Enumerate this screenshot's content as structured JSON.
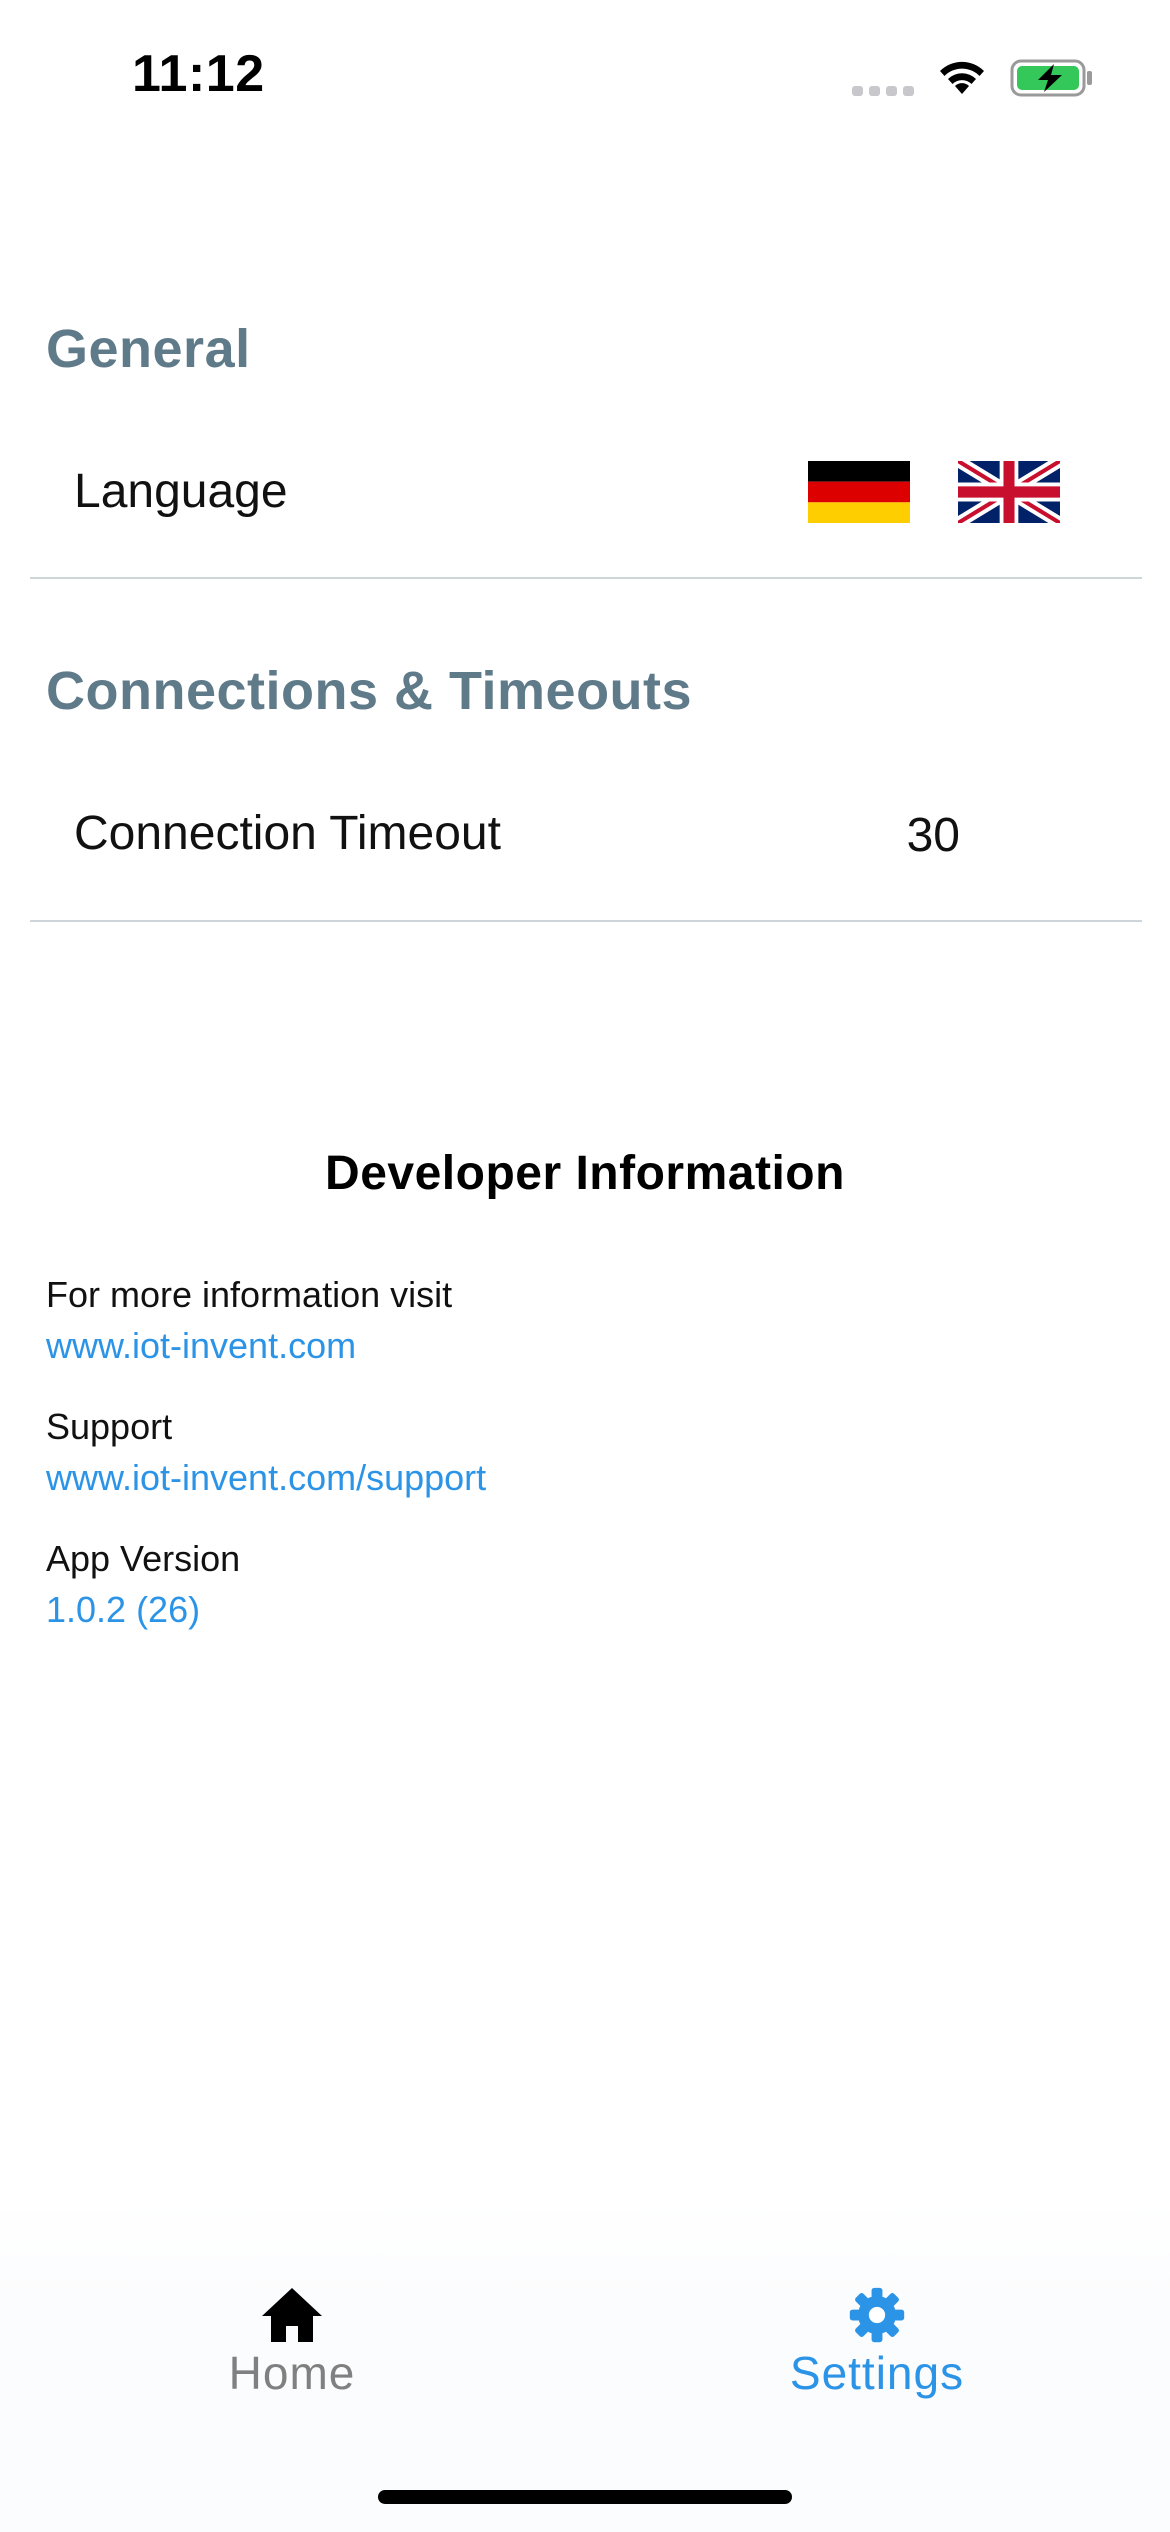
{
  "status_bar": {
    "time": "11:12"
  },
  "general": {
    "header": "General",
    "language_label": "Language",
    "flags": [
      "german-flag",
      "uk-flag"
    ]
  },
  "connections": {
    "header": "Connections & Timeouts",
    "timeout_label": "Connection Timeout",
    "timeout_value": "30"
  },
  "developer": {
    "title": "Developer Information",
    "more_info_label": "For more information visit",
    "more_info_link": "www.iot-invent.com",
    "support_label": "Support",
    "support_link": "www.iot-invent.com/support",
    "version_label": "App Version",
    "version_value": "1.0.2 (26)"
  },
  "tab_bar": {
    "tabs": [
      {
        "label": "Home",
        "icon": "home-icon",
        "active": false,
        "color": "#808080"
      },
      {
        "label": "Settings",
        "icon": "gear-icon",
        "active": true,
        "color": "#2c94e6"
      }
    ]
  },
  "colors": {
    "section_header": "#5f7a89",
    "link": "#2c94e6",
    "divider": "#cfd6da"
  }
}
